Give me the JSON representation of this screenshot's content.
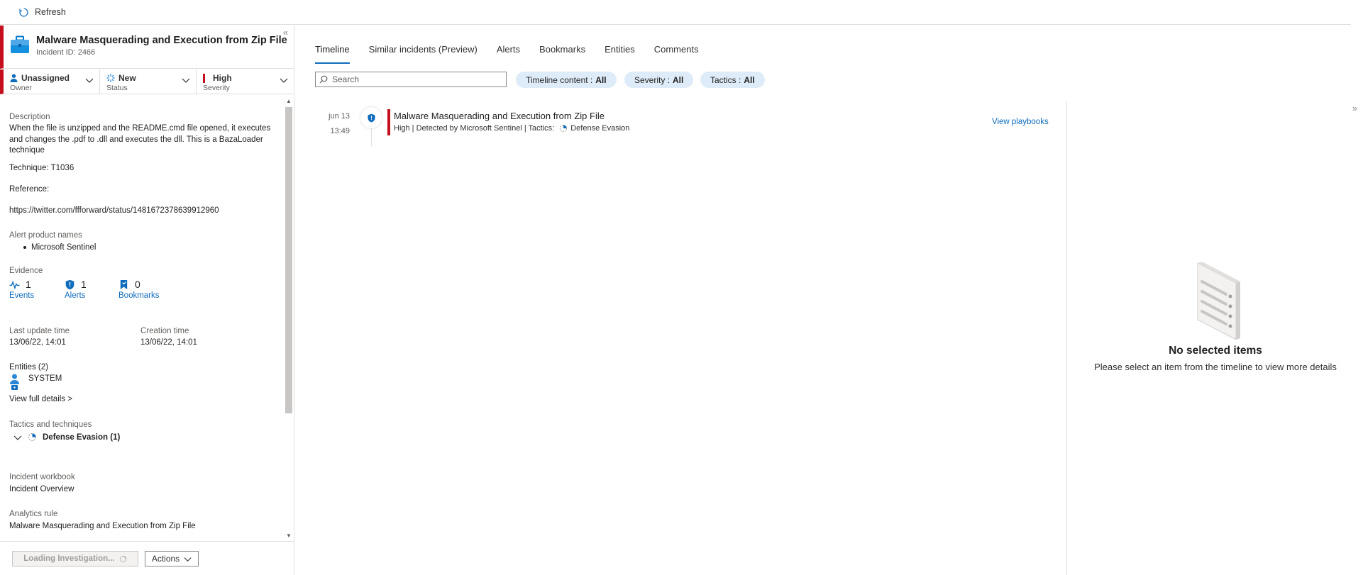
{
  "toolbar": {
    "refresh_label": "Refresh"
  },
  "incident": {
    "title": "Malware Masquerading and Execution from Zip File",
    "id_label": "Incident ID: 2466",
    "collapse_icon": "«",
    "owner": {
      "value": "Unassigned",
      "label": "Owner"
    },
    "status": {
      "value": "New",
      "label": "Status"
    },
    "severity": {
      "value": "High",
      "label": "Severity",
      "color": "#c50f1f"
    }
  },
  "details": {
    "description_label": "Description",
    "description_text": "When the file is unzipped and the README.cmd file opened, it executes and changes the .pdf to .dll and executes the dll. This is a BazaLoader technique",
    "technique": "Technique: T1036",
    "reference_label": "Reference:",
    "reference_link": "https://twitter.com/ffforward/status/1481672378639912960",
    "alert_products_label": "Alert product names",
    "alert_products": [
      "Microsoft Sentinel"
    ],
    "evidence_label": "Evidence",
    "evidence": [
      {
        "icon": "events-icon",
        "count": "1",
        "label": "Events"
      },
      {
        "icon": "alerts-shield-icon",
        "count": "1",
        "label": "Alerts"
      },
      {
        "icon": "bookmark-icon",
        "count": "0",
        "label": "Bookmarks"
      }
    ],
    "last_update_label": "Last update time",
    "last_update_value": "13/06/22, 14:01",
    "creation_label": "Creation time",
    "creation_value": "13/06/22, 14:01",
    "entities_label": "Entities (2)",
    "entity_name": "SYSTEM",
    "view_full_details": "View full details >",
    "tactics_label": "Tactics and techniques",
    "tactic_item": "Defense Evasion (1)",
    "workbook_label": "Incident workbook",
    "workbook_link": "Incident Overview",
    "analytics_label": "Analytics rule",
    "analytics_link": "Malware Masquerading and Execution from Zip File"
  },
  "footer": {
    "loading_label": "Loading Investigation...",
    "actions_label": "Actions"
  },
  "tabs": [
    {
      "label": "Timeline",
      "active": true
    },
    {
      "label": "Similar incidents (Preview)",
      "active": false
    },
    {
      "label": "Alerts",
      "active": false
    },
    {
      "label": "Bookmarks",
      "active": false
    },
    {
      "label": "Entities",
      "active": false
    },
    {
      "label": "Comments",
      "active": false
    }
  ],
  "filters": {
    "search_placeholder": "Search",
    "timeline_content_label": "Timeline content :",
    "timeline_content_value": "All",
    "severity_label": "Severity :",
    "severity_value": "All",
    "tactics_label": "Tactics :",
    "tactics_value": "All"
  },
  "timeline": [
    {
      "date": "jun 13",
      "time": "13:49",
      "title": "Malware Masquerading and Execution from Zip File",
      "meta": "High | Detected by Microsoft Sentinel | Tactics:",
      "tactic": "Defense Evasion",
      "action": "View playbooks"
    }
  ],
  "details_panel": {
    "expand_icon": "»",
    "empty_title": "No selected items",
    "empty_subtitle": "Please select an item from the timeline to view more details"
  },
  "colors": {
    "accent": "#0f6cbd",
    "severity_high": "#c50f1f",
    "pill_bg": "#deecf9"
  }
}
